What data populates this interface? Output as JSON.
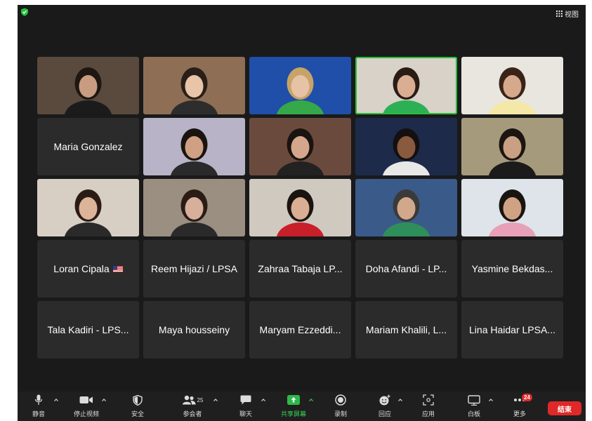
{
  "header": {
    "view_label": "视图",
    "view_icon": "grid-icon",
    "security_icon": "shield-check-icon"
  },
  "participants": [
    {
      "name": "",
      "video": true,
      "bg": "#5a4a3d",
      "shirt": "#1b1b1b",
      "skin": "#c89c80",
      "hair": "#1e1712"
    },
    {
      "name": "",
      "video": true,
      "bg": "#8e6f55",
      "shirt": "#2d2d2d",
      "skin": "#e8c4a8",
      "hair": "#2a1f18"
    },
    {
      "name": "",
      "video": true,
      "bg": "#1f4fa8",
      "shirt": "#35a84a",
      "skin": "#e6c2a6",
      "hair": "#c7a368"
    },
    {
      "name": "",
      "video": true,
      "bg": "#d8d2c8",
      "shirt": "#2db055",
      "skin": "#d9ae92",
      "hair": "#2a1c15",
      "active": true
    },
    {
      "name": "",
      "video": true,
      "bg": "#e9e6e0",
      "shirt": "#f4e8a8",
      "skin": "#d6a98c",
      "hair": "#3a2418"
    },
    {
      "name": "Maria Gonzalez",
      "video": false
    },
    {
      "name": "",
      "video": true,
      "bg": "#b9b3c7",
      "shirt": "#2a2a2a",
      "skin": "#cfa084",
      "hair": "#1a1410"
    },
    {
      "name": "",
      "video": true,
      "bg": "#6b4a3e",
      "shirt": "#222222",
      "skin": "#d4a78c",
      "hair": "#1a1410"
    },
    {
      "name": "",
      "video": true,
      "bg": "#1d2a4a",
      "shirt": "#e8e8e8",
      "skin": "#8a5a3e",
      "hair": "#141010"
    },
    {
      "name": "",
      "video": true,
      "bg": "#a69a7c",
      "shirt": "#1b1b1b",
      "skin": "#caa084",
      "hair": "#1c1510"
    },
    {
      "name": "",
      "video": true,
      "bg": "#d8cfc4",
      "shirt": "#2a2a2a",
      "skin": "#dcb49a",
      "hair": "#2a1c15"
    },
    {
      "name": "",
      "video": true,
      "bg": "#9a8f80",
      "shirt": "#2a2a2a",
      "skin": "#d6b09a",
      "hair": "#2a1c15"
    },
    {
      "name": "",
      "video": true,
      "bg": "#cfc9c0",
      "shirt": "#c8202a",
      "skin": "#d9ae92",
      "hair": "#1a1410"
    },
    {
      "name": "",
      "video": true,
      "bg": "#3a5a8a",
      "shirt": "#2f8f5a",
      "skin": "#d2a88c",
      "hair": "#3a3a3a"
    },
    {
      "name": "",
      "video": true,
      "bg": "#dfe4ea",
      "shirt": "#e8a0b8",
      "skin": "#d0a284",
      "hair": "#1a1410"
    },
    {
      "name": "Loran Cipala",
      "video": false,
      "flag": true
    },
    {
      "name": "Reem Hijazi / LPSA",
      "video": false
    },
    {
      "name": "Zahraa Tabaja LP...",
      "video": false
    },
    {
      "name": "Doha Afandi - LP...",
      "video": false
    },
    {
      "name": "Yasmine Bekdas...",
      "video": false
    },
    {
      "name": "Tala Kadiri - LPS...",
      "video": false
    },
    {
      "name": "Maya housseiny",
      "video": false
    },
    {
      "name": "Maryam Ezzeddi...",
      "video": false
    },
    {
      "name": "Mariam Khalili, L...",
      "video": false
    },
    {
      "name": "Lina Haidar LPSA...",
      "video": false
    }
  ],
  "toolbar": {
    "mute": "静音",
    "stop_video": "停止视频",
    "security": "安全",
    "participants": "参会者",
    "participants_count": "25",
    "chat": "聊天",
    "share_screen": "共享屏幕",
    "record": "录制",
    "reactions": "回应",
    "apps": "应用",
    "whiteboard": "白板",
    "more": "更多",
    "more_badge": "24",
    "end": "结束"
  },
  "colors": {
    "accent_green": "#39d353",
    "end_red": "#e02828",
    "window_bg": "#1a1a1a",
    "tile_bg": "#2b2b2b"
  }
}
